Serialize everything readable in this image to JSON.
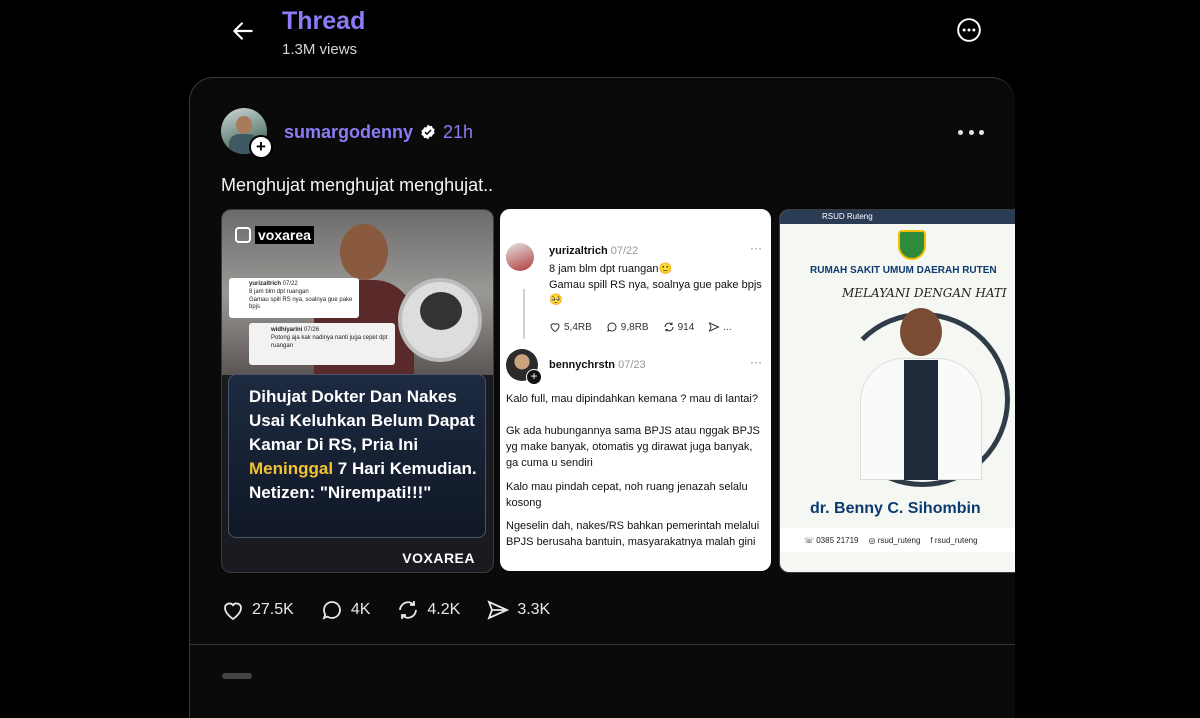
{
  "header": {
    "back_icon": "arrow-left-icon",
    "title": "Thread",
    "views": "1.3M views",
    "more_icon": "more-circle-icon"
  },
  "post": {
    "username": "sumargodenny",
    "verified": true,
    "time": "21h",
    "text": "Menghujat menghujat menghujat..",
    "actions": {
      "likes": "27.5K",
      "replies": "4K",
      "reposts": "4.2K",
      "shares": "3.3K"
    }
  },
  "media": [
    {
      "logo": "voxarea",
      "comment1_user": "yurizaltrich",
      "comment1_date": "07/22",
      "comment1_text": "8 jam blm dpt ruangan",
      "comment1_text2": "Gamau spill RS nya, soalnya gue pake bpjs",
      "comment2_user": "widhiyarini",
      "comment2_date": "07/26",
      "comment2_text": "Potong aja kak nadinya nanti juga cepet dpt ruangan",
      "headline_pre": "Dihujat Dokter Dan Nakes Usai Keluhkan Belum Dapat Kamar Di RS, Pria Ini ",
      "headline_highlight": "Meninggal",
      "headline_post": " 7 Hari Kemudian. Netizen: \"Nirempati!!!\"",
      "brand": "VOXAREA"
    },
    {
      "user1": "yurizaltrich",
      "date1": "07/22",
      "line1": "8 jam blm dpt ruangan🙂",
      "line2": "Gamau spill RS nya, soalnya gue pake bpjs 🥺",
      "likes": "5,4RB",
      "replies": "9,8RB",
      "reposts": "914",
      "share_more": "...",
      "user2": "bennychrstn",
      "date2": "07/23",
      "para1": "Kalo full, mau dipindahkan kemana ? mau di lantai?",
      "para2": "Gk ada hubungannya sama BPJS atau nggak BPJS yg make banyak, otomatis yg dirawat juga banyak, ga cuma u sendiri",
      "para3": "Kalo mau pindah cepat, noh ruang jenazah selalu kosong",
      "para4": "Ngeselin dah, nakes/RS bahkan pemerintah melalui BPJS berusaha bantuin, masyarakatnya malah gini"
    },
    {
      "top": "RSUD Ruteng",
      "hospital": "RUMAH SAKIT UMUM DAERAH RUTEN",
      "motto": "MELAYANI DENGAN HATI",
      "doctor": "dr. Benny C. Sihombin",
      "phone": "0385 21719",
      "ig": "rsud_ruteng",
      "fb": "rsud_ruteng"
    }
  ],
  "colors": {
    "accent": "#8b7cf6",
    "background": "#000000",
    "highlight": "#f1c232"
  }
}
